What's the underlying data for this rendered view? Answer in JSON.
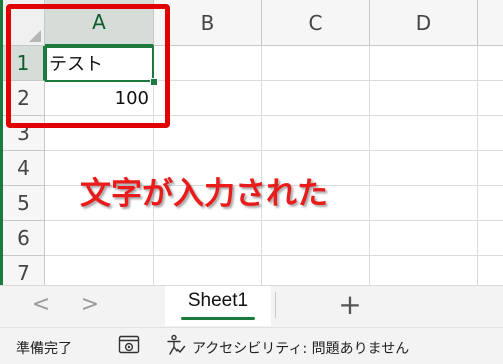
{
  "grid": {
    "columns": [
      "A",
      "B",
      "C",
      "D"
    ],
    "rows": [
      "1",
      "2",
      "3",
      "4",
      "5",
      "6",
      "7"
    ],
    "cells": {
      "A1": "テスト",
      "A2": "100"
    }
  },
  "annotation": {
    "text": "文字が入力された",
    "color": "#ea1b1b"
  },
  "sheet_tabs": {
    "prev_icon": "<",
    "next_icon": ">",
    "active_sheet": "Sheet1",
    "add_icon": "+"
  },
  "status_bar": {
    "ready": "準備完了",
    "accessibility": "アクセシビリティ: 問題ありません"
  },
  "colors": {
    "accent": "#1d7a3f",
    "highlight_box": "#e00000"
  }
}
